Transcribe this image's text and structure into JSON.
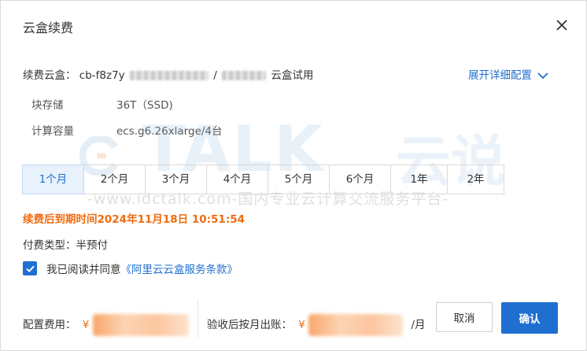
{
  "dialog": {
    "title": "云盒续费",
    "expand_label": "展开详细配置"
  },
  "renew_box": {
    "label": "续费云盒：",
    "id_prefix": "cb-f8z7y",
    "separator": "/",
    "suffix": "云盒试用"
  },
  "specs": [
    {
      "label": "块存储",
      "value": "36T（SSD)"
    },
    {
      "label": "计算容量",
      "value": "ecs.g6.26xlarge/4台"
    }
  ],
  "months": [
    {
      "label": "1个月",
      "active": true
    },
    {
      "label": "2个月",
      "active": false
    },
    {
      "label": "3个月",
      "active": false
    },
    {
      "label": "4个月",
      "active": false
    },
    {
      "label": "5个月",
      "active": false
    },
    {
      "label": "6个月",
      "active": false
    },
    {
      "label": "1年",
      "active": false
    },
    {
      "label": "2年",
      "active": false
    }
  ],
  "expire_text": "续费后到期时间2024年11月18日 10:51:54",
  "pay_type": "付费类型：半预付",
  "agreement": {
    "checked": true,
    "text": "我已阅读并同意",
    "link": "《阿里云云盒服务条款》"
  },
  "footer": {
    "config_fee_label": "配置费用：",
    "currency": "¥",
    "monthly_label": "验收后按月出账：",
    "per_month": "/月",
    "cancel_label": "取消",
    "confirm_label": "确认"
  },
  "watermark": {
    "logo": "TALK",
    "logo_cn": "云说",
    "url": "-www.idctalk.com-国内专业云计算交流服务平台-"
  },
  "colors": {
    "accent": "#1f6fd1",
    "warning": "#f06b0f",
    "active_tab_bg": "#e8f2fd"
  }
}
